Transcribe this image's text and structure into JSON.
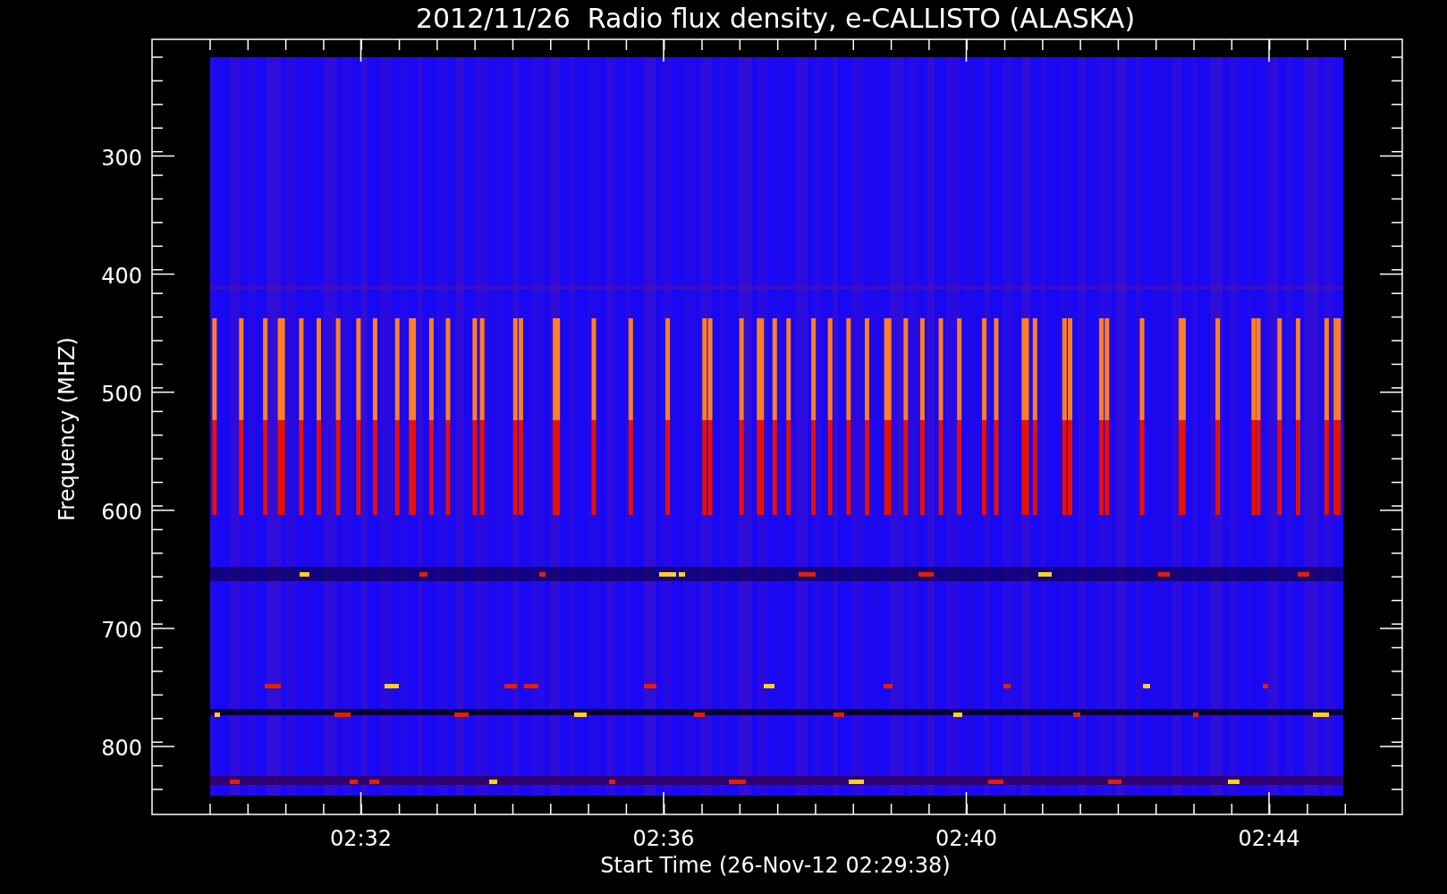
{
  "title": "2012/11/26  Radio flux density, e-CALLISTO (ALASKA)",
  "y_axis": {
    "label": "Frequency (MHZ)",
    "ticks": [
      "300",
      "400",
      "500",
      "600",
      "700",
      "800"
    ]
  },
  "x_axis": {
    "label": "Start Time (26-Nov-12 02:29:38)",
    "ticks": [
      "02:32",
      "02:36",
      "02:40",
      "02:44"
    ]
  }
}
